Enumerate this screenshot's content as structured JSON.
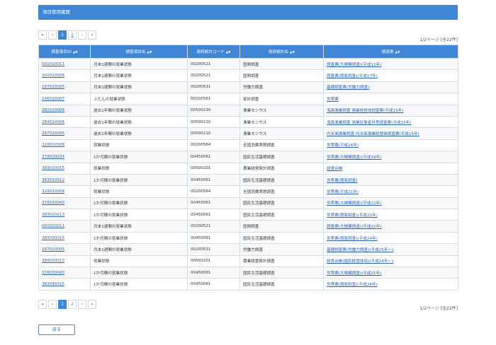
{
  "header": {
    "title": "項目使用履歴"
  },
  "pager": {
    "items": [
      "«",
      "‹",
      "1",
      "2",
      "›",
      "»"
    ],
    "count_text": "1/2ページ [全22件]"
  },
  "table": {
    "headers": [
      "調査項目ID",
      "調査項目名",
      "政府統計コード",
      "政府統計名",
      "調査票"
    ],
    "sort_icon": "sort-icon",
    "rows": [
      [
        "001010011",
        "月末1週間の就業状態",
        "00200521",
        "国勢調査",
        "調査票(大規模調査)(平成12年)"
      ],
      [
        "002010006",
        "月末1週間の就業状態",
        "00200521",
        "国勢調査",
        "調査票(簡易調査)(平成17年)"
      ],
      [
        "187010005",
        "月末1週間の就業状態",
        "00200531",
        "労働力調査",
        "基礎調査票(労働力調査)"
      ],
      [
        "246010007",
        "ふだんの就業状態",
        "00200561",
        "家計調査",
        "世帯票"
      ],
      [
        "282010006",
        "過去1年間の就業状態",
        "00500210",
        "漁業センサス",
        "海面漁業調査 漁業経営体調査票(平成15年)"
      ],
      [
        "284010006",
        "過去1年間の就業状態",
        "00500210",
        "漁業センサス",
        "海面漁業調査 漁業従事者世帯調査票(平成15年)"
      ],
      [
        "287010005",
        "過去1年間の就業状態",
        "00500210",
        "漁業センサス",
        "内水面漁業調査 内水面漁業経営体調査票(平成15年)"
      ],
      [
        "329010008",
        "就業状態",
        "00200564",
        "全国消費実態調査",
        "世帯票(平成16年)"
      ],
      [
        "378010034",
        "1か月間の就業状態",
        "00450061",
        "国民生活基礎調査",
        "世帯票(大規模調査)(平成19年)"
      ],
      [
        "389010015",
        "就業状態",
        "00500201",
        "農業経営統計調査",
        "経営台帳"
      ],
      [
        "383010012",
        "1か月間の就業状態",
        "00450061",
        "国民生活基礎調査",
        "世帯票(簡易調査)"
      ],
      [
        "329020008",
        "就業状態",
        "00200564",
        "全国消費実態調査",
        "世帯票(平成21年)"
      ],
      [
        "378020043",
        "1か月間の就業状態",
        "00450061",
        "国民生活基礎調査",
        "世帯票(大規模調査)(平成22年)"
      ],
      [
        "383020013",
        "1か月間の就業状態",
        "00450061",
        "国民生活基礎調査",
        "世帯票(簡易調査)(平成21年)"
      ],
      [
        "001020011",
        "月末1週間の就業状態",
        "00200521",
        "国勢調査",
        "調査票(大規模調査)(平成22年)"
      ],
      [
        "383030015",
        "1か月間の就業状態",
        "00450061",
        "国民生活基礎調査",
        "世帯票(簡易調査)(平成24年)"
      ],
      [
        "187020005",
        "月末1週間の就業状態",
        "00200531",
        "労働力調査",
        "基礎調査票(労働力調査)(平成25年〜)"
      ],
      [
        "389020013",
        "就業状態",
        "00500201",
        "農業経営統計調査",
        "経営台帳(個別経営体用)(平成24年〜)"
      ],
      [
        "378030043",
        "1か月間の就業状態",
        "00450061",
        "国民生活基礎調査",
        "世帯票(大規模調査)(平成25年)"
      ],
      [
        "383040015",
        "1か月間の就業状態",
        "00450061",
        "国民生活基礎調査",
        "世帯票(簡易調査)(平成26年)"
      ]
    ]
  },
  "back_label": "戻る"
}
